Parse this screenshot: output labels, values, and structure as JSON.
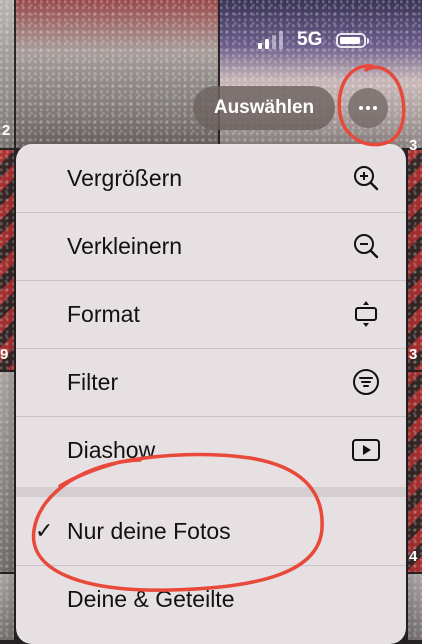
{
  "status_bar": {
    "network": "5G",
    "signal_bars_active": 2,
    "signal_bars_total": 4,
    "battery_level": 0.9
  },
  "header": {
    "select_label": "Auswählen",
    "more_icon": "ellipsis-icon"
  },
  "background": {
    "tile_numbers": [
      "2",
      "3",
      "9",
      "3",
      "4"
    ]
  },
  "menu": {
    "items": [
      {
        "label": "Vergrößern",
        "icon": "zoom-in-icon"
      },
      {
        "label": "Verkleinern",
        "icon": "zoom-out-icon"
      },
      {
        "label": "Format",
        "icon": "aspect-ratio-icon"
      },
      {
        "label": "Filter",
        "icon": "filter-icon"
      },
      {
        "label": "Diashow",
        "icon": "slideshow-play-icon"
      }
    ],
    "library_options": [
      {
        "label": "Nur deine Fotos",
        "checkmark": "✓",
        "selected": true
      },
      {
        "label": "Deine & Geteilte",
        "selected": false
      }
    ]
  },
  "colors": {
    "annotation_red": "#e8493a",
    "menu_background": "#ece6e8"
  }
}
